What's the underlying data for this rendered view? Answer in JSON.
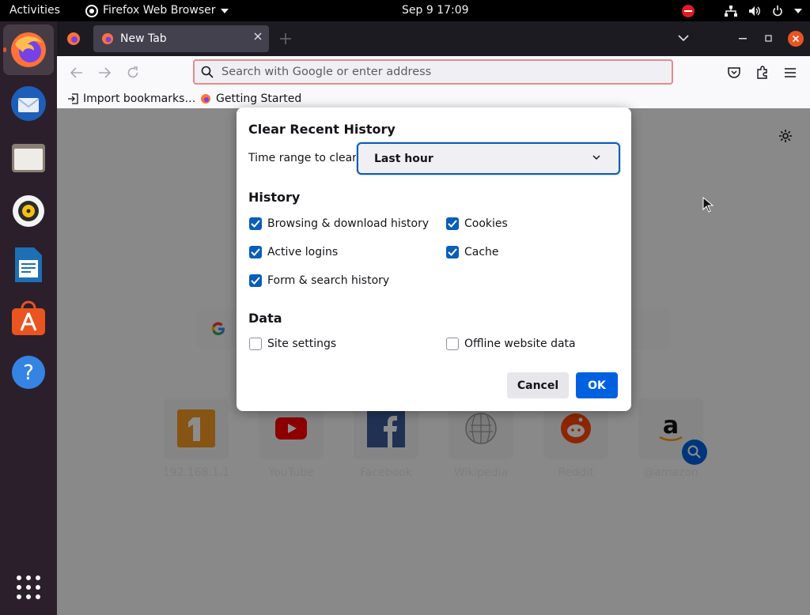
{
  "topbar": {
    "activities": "Activities",
    "app_name": "Firefox Web Browser",
    "clock": "Sep 9  17:09"
  },
  "dock": {
    "items": [
      {
        "name": "firefox-icon",
        "active": true
      },
      {
        "name": "thunderbird-icon"
      },
      {
        "name": "files-icon"
      },
      {
        "name": "rhythmbox-icon"
      },
      {
        "name": "writer-icon"
      },
      {
        "name": "software-icon"
      },
      {
        "name": "help-icon"
      },
      {
        "name": "show-apps-icon"
      }
    ]
  },
  "browser": {
    "tab_title": "New Tab",
    "url_placeholder": "Search with Google or enter address",
    "bookmarks": [
      "Import bookmarks…",
      "Getting Started"
    ]
  },
  "shortcuts": [
    {
      "label": "192.168.1.1"
    },
    {
      "label": "YouTube"
    },
    {
      "label": "Facebook"
    },
    {
      "label": "Wikipedia"
    },
    {
      "label": "Reddit"
    },
    {
      "label": "@amazon"
    }
  ],
  "dialog": {
    "title": "Clear Recent History",
    "range_label": "Time range to clear:",
    "range_value": "Last hour",
    "history_heading": "History",
    "history_options": [
      {
        "label": "Browsing & download history",
        "checked": true
      },
      {
        "label": "Cookies",
        "checked": true
      },
      {
        "label": "Active logins",
        "checked": true
      },
      {
        "label": "Cache",
        "checked": true
      },
      {
        "label": "Form & search history",
        "checked": true
      }
    ],
    "data_heading": "Data",
    "data_options": [
      {
        "label": "Site settings",
        "checked": false
      },
      {
        "label": "Offline website data",
        "checked": false
      }
    ],
    "cancel": "Cancel",
    "ok": "OK"
  },
  "colors": {
    "accent": "#0061e0",
    "checkbox": "#0a5dba",
    "ubuntu_orange": "#e95420",
    "dock_bg": "#2b1f2b"
  }
}
